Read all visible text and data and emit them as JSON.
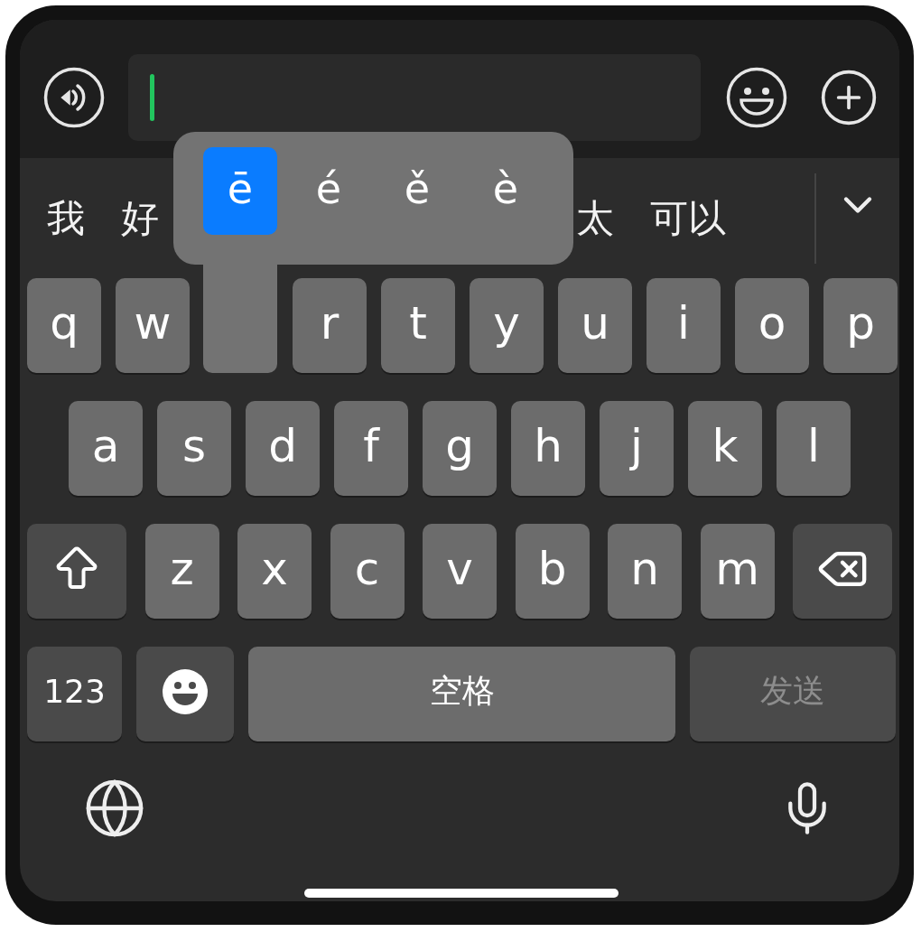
{
  "candidates": [
    {
      "text": "我"
    },
    {
      "text": "好"
    },
    {
      "text": "太"
    },
    {
      "text": "可以"
    }
  ],
  "accent_popup": {
    "options": [
      {
        "label": "ē",
        "selected": true
      },
      {
        "label": "é",
        "selected": false
      },
      {
        "label": "ě",
        "selected": false
      },
      {
        "label": "è",
        "selected": false
      }
    ]
  },
  "keyboard": {
    "rows": [
      [
        {
          "kind": "letter",
          "label": "q"
        },
        {
          "kind": "letter",
          "label": "w"
        },
        {
          "kind": "covered"
        },
        {
          "kind": "letter",
          "label": "r"
        },
        {
          "kind": "letter",
          "label": "t"
        },
        {
          "kind": "letter",
          "label": "y"
        },
        {
          "kind": "letter",
          "label": "u"
        },
        {
          "kind": "letter",
          "label": "i"
        },
        {
          "kind": "letter",
          "label": "o"
        },
        {
          "kind": "letter",
          "label": "p"
        }
      ],
      [
        {
          "kind": "letter",
          "label": "a"
        },
        {
          "kind": "letter",
          "label": "s"
        },
        {
          "kind": "letter",
          "label": "d"
        },
        {
          "kind": "letter",
          "label": "f"
        },
        {
          "kind": "letter",
          "label": "g"
        },
        {
          "kind": "letter",
          "label": "h"
        },
        {
          "kind": "letter",
          "label": "j"
        },
        {
          "kind": "letter",
          "label": "k"
        },
        {
          "kind": "letter",
          "label": "l"
        }
      ],
      [
        {
          "kind": "shift"
        },
        {
          "kind": "letter",
          "label": "z"
        },
        {
          "kind": "letter",
          "label": "x"
        },
        {
          "kind": "letter",
          "label": "c"
        },
        {
          "kind": "letter",
          "label": "v"
        },
        {
          "kind": "letter",
          "label": "b"
        },
        {
          "kind": "letter",
          "label": "n"
        },
        {
          "kind": "letter",
          "label": "m"
        },
        {
          "kind": "backspace"
        }
      ]
    ],
    "bottom_keys": [
      {
        "kind": "numbers",
        "label": "123"
      },
      {
        "kind": "emoji"
      },
      {
        "kind": "space",
        "label": "空格"
      },
      {
        "kind": "send",
        "label": "发送",
        "disabled": true
      }
    ]
  }
}
